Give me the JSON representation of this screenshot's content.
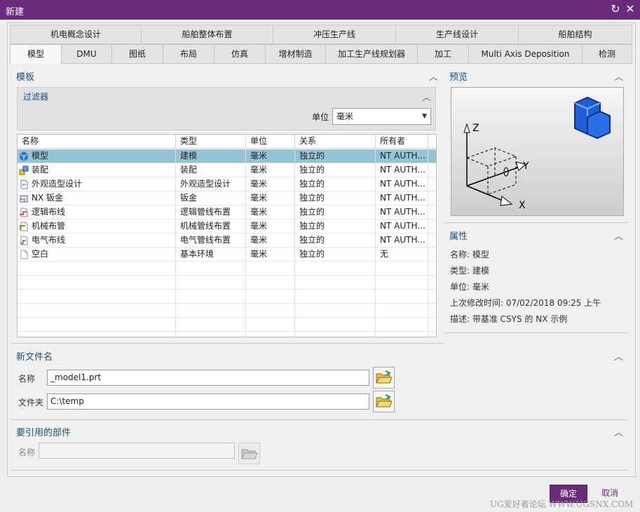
{
  "window": {
    "title": "新建"
  },
  "tabs_row1": [
    {
      "label": "机电概念设计"
    },
    {
      "label": "船舶整体布置"
    },
    {
      "label": "冲压生产线"
    },
    {
      "label": "生产线设计"
    },
    {
      "label": "船舶结构"
    }
  ],
  "tabs_row2": [
    {
      "label": "模型",
      "active": true
    },
    {
      "label": "DMU"
    },
    {
      "label": "图纸"
    },
    {
      "label": "布局"
    },
    {
      "label": "仿真"
    },
    {
      "label": "增材制造"
    },
    {
      "label": "加工生产线规划器"
    },
    {
      "label": "加工"
    },
    {
      "label": "Multi Axis Deposition"
    },
    {
      "label": "检测"
    }
  ],
  "template": {
    "title": "模板",
    "filter": {
      "title": "过滤器",
      "unit_label": "单位",
      "unit_value": "毫米"
    },
    "columns": [
      "名称",
      "类型",
      "单位",
      "关系",
      "所有者"
    ],
    "rows": [
      {
        "icon": "model-icon",
        "name": "模型",
        "type": "建模",
        "unit": "毫米",
        "relation": "独立的",
        "owner": "NT AUTH...",
        "selected": true
      },
      {
        "icon": "assembly-icon",
        "name": "装配",
        "type": "装配",
        "unit": "毫米",
        "relation": "独立的",
        "owner": "NT AUTH..."
      },
      {
        "icon": "shape-design-icon",
        "name": "外观造型设计",
        "type": "外观造型设计",
        "unit": "毫米",
        "relation": "独立的",
        "owner": "NT AUTH..."
      },
      {
        "icon": "sheet-metal-icon",
        "name": "NX 钣金",
        "type": "钣金",
        "unit": "毫米",
        "relation": "独立的",
        "owner": "NT AUTH..."
      },
      {
        "icon": "logic-routing-icon",
        "name": "逻辑布线",
        "type": "逻辑管线布置",
        "unit": "毫米",
        "relation": "独立的",
        "owner": "NT AUTH..."
      },
      {
        "icon": "mech-routing-icon",
        "name": "机械布管",
        "type": "机械管线布置",
        "unit": "毫米",
        "relation": "独立的",
        "owner": "NT AUTH..."
      },
      {
        "icon": "elec-routing-icon",
        "name": "电气布线",
        "type": "电气管线布置",
        "unit": "毫米",
        "relation": "独立的",
        "owner": "NT AUTH..."
      },
      {
        "icon": "blank-icon",
        "name": "空白",
        "type": "基本环境",
        "unit": "毫米",
        "relation": "独立的",
        "owner": "无"
      }
    ]
  },
  "preview": {
    "title": "预览",
    "axis_x": "X",
    "axis_y": "Y",
    "axis_z": "Z"
  },
  "properties": {
    "title": "属性",
    "name_line": "名称:  模型",
    "type_line": "类型:  建模",
    "unit_line": "单位:  毫米",
    "modified_line": "上次修改时间:   07/02/2018 09:25 上午",
    "desc_line": "描述:   带基准 CSYS 的 NX 示例"
  },
  "new_file": {
    "title": "新文件名",
    "name_label": "名称",
    "name_value": "_model1.prt",
    "folder_label": "文件夹",
    "folder_value": "C:\\temp"
  },
  "referenced": {
    "title": "要引用的部件",
    "name_label": "名称",
    "name_value": ""
  },
  "buttons": {
    "ok": "确定",
    "cancel": "取消"
  },
  "watermark": "UG爱好者论坛 WWW.UGSNX.COM",
  "colors": {
    "titlebar": "#6a2b7c",
    "selection": "#93c5d7",
    "section_text": "#1c4f7a"
  }
}
